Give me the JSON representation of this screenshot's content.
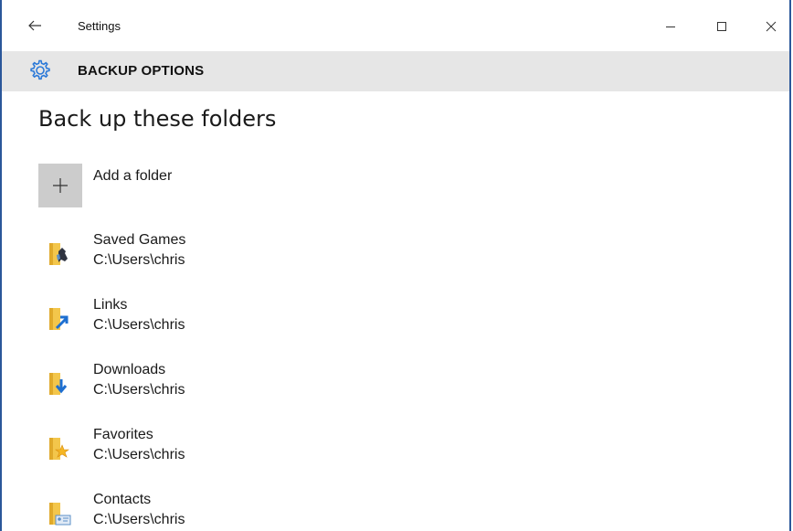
{
  "window": {
    "app_title": "Settings",
    "controls": {
      "minimize": "minimize-icon",
      "maximize": "maximize-icon",
      "close": "close-icon"
    }
  },
  "header": {
    "title": "BACKUP OPTIONS",
    "icon": "gear-icon"
  },
  "section": {
    "title": "Back up these folders"
  },
  "add_folder": {
    "label": "Add a folder",
    "icon": "plus-icon"
  },
  "folders": [
    {
      "name": "Saved Games",
      "path": "C:\\Users\\chris",
      "icon": "saved-games-folder-icon"
    },
    {
      "name": "Links",
      "path": "C:\\Users\\chris",
      "icon": "links-folder-icon"
    },
    {
      "name": "Downloads",
      "path": "C:\\Users\\chris",
      "icon": "downloads-folder-icon"
    },
    {
      "name": "Favorites",
      "path": "C:\\Users\\chris",
      "icon": "favorites-folder-icon"
    },
    {
      "name": "Contacts",
      "path": "C:\\Users\\chris",
      "icon": "contacts-folder-icon"
    }
  ],
  "colors": {
    "accent": "#2b79d8",
    "header_bg": "#e6e6e6",
    "border": "#2b579a",
    "folder": "#f3c64b"
  }
}
